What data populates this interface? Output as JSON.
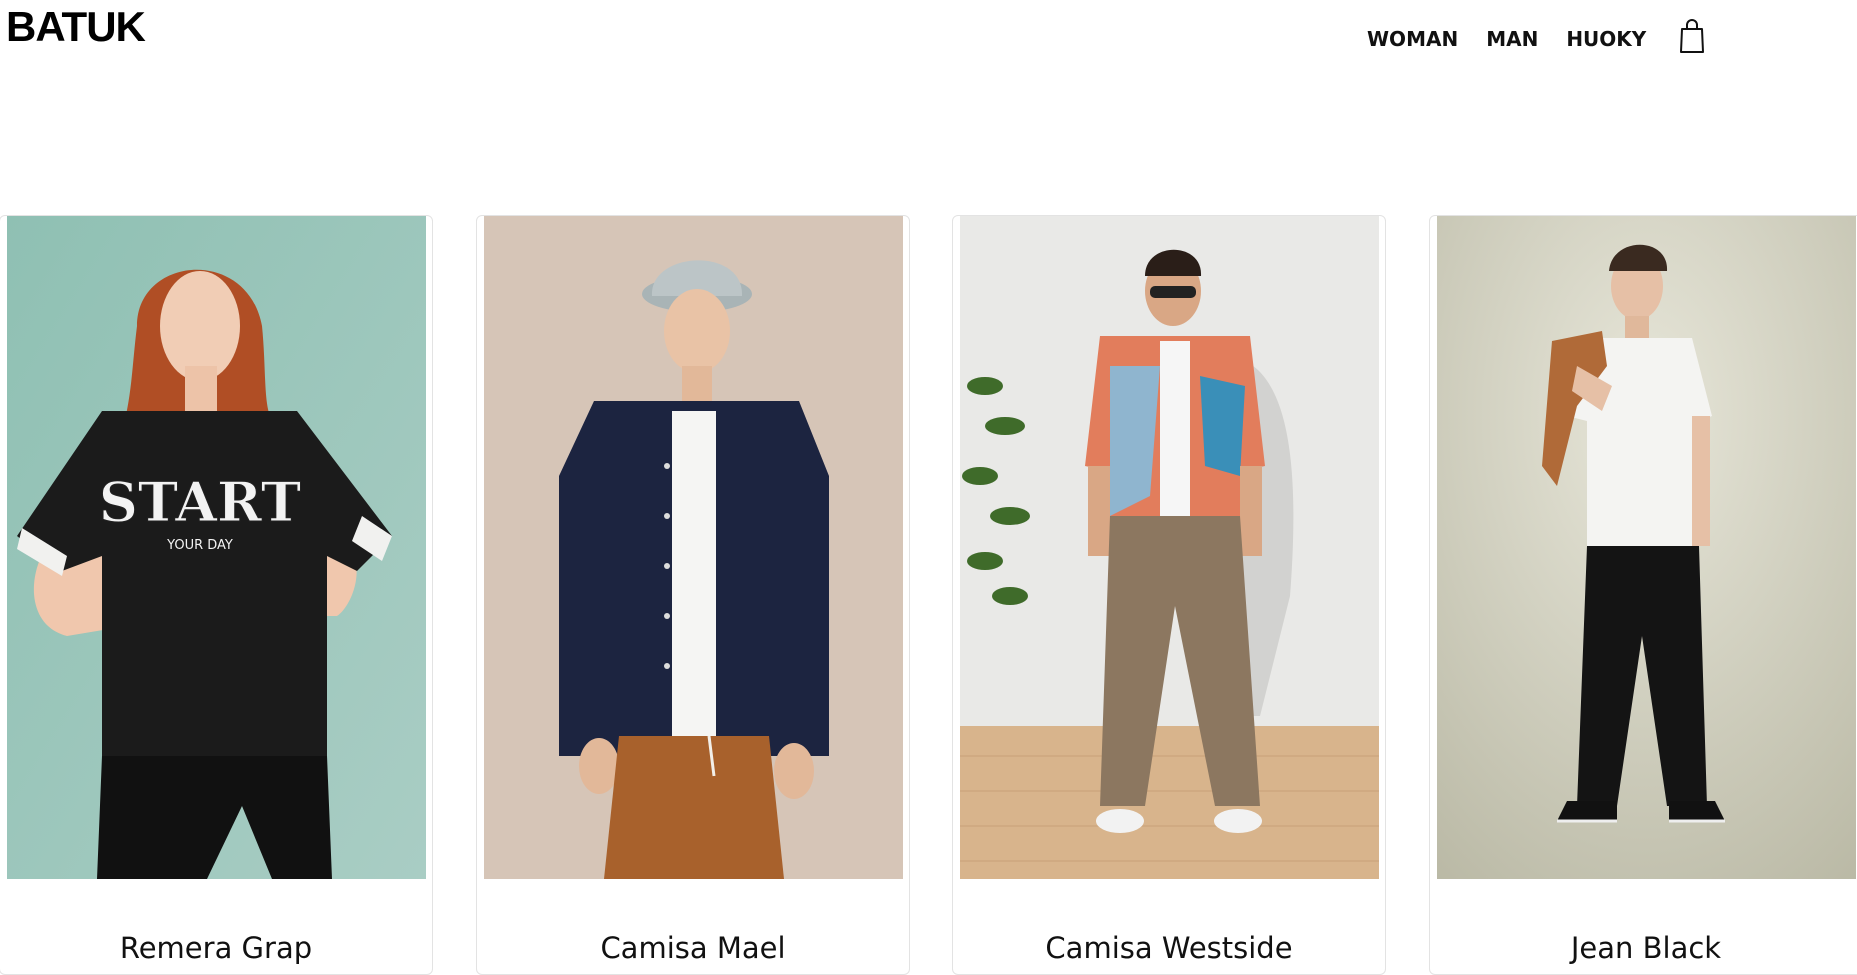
{
  "brand": {
    "logo": "BATUK"
  },
  "nav": {
    "items": [
      {
        "label": "WOMAN"
      },
      {
        "label": "MAN"
      },
      {
        "label": "HUOKY"
      }
    ],
    "cart_icon": "shopping-bag-icon"
  },
  "products": [
    {
      "name": "Remera Grap",
      "photo_text": "START",
      "photo_subtext": "YOUR DAY"
    },
    {
      "name": "Camisa Mael"
    },
    {
      "name": "Camisa Westside"
    },
    {
      "name": "Jean Black"
    }
  ],
  "colors": {
    "background": "#ffffff",
    "text": "#111111",
    "card_border": "#e3e3e3"
  }
}
